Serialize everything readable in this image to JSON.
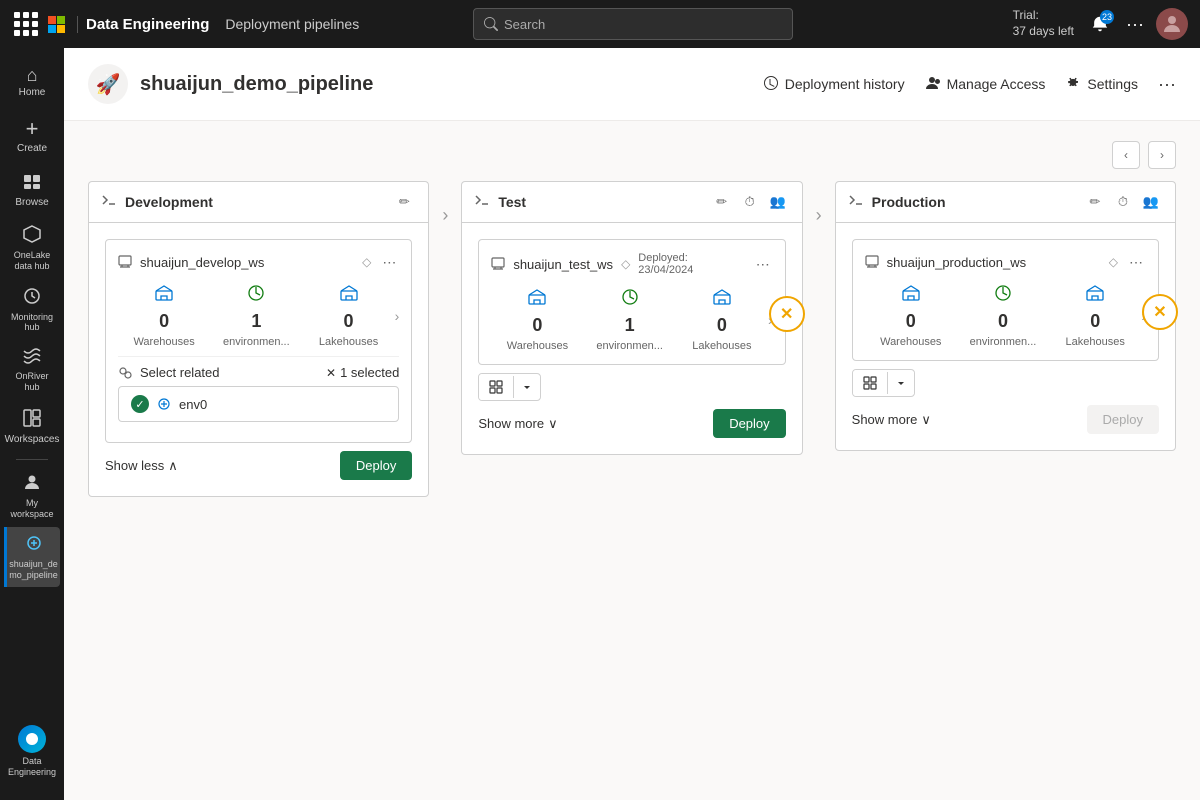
{
  "topbar": {
    "brand": "Data Engineering",
    "page": "Deployment pipelines",
    "search_placeholder": "Search",
    "trial_line1": "Trial:",
    "trial_line2": "37 days left",
    "notif_count": "23"
  },
  "sidebar": {
    "items": [
      {
        "id": "home",
        "label": "Home",
        "icon": "⌂"
      },
      {
        "id": "create",
        "label": "Create",
        "icon": "+"
      },
      {
        "id": "browse",
        "label": "Browse",
        "icon": "📁"
      },
      {
        "id": "onelake",
        "label": "OneLake data hub",
        "icon": "⬡"
      },
      {
        "id": "monitoring",
        "label": "Monitoring hub",
        "icon": "⟳"
      },
      {
        "id": "oneriver",
        "label": "OnRiver hub",
        "icon": "〜"
      },
      {
        "id": "workspaces",
        "label": "Workspaces",
        "icon": "◫"
      },
      {
        "id": "myworkspace",
        "label": "My workspace",
        "icon": "👤"
      },
      {
        "id": "shuaijun",
        "label": "shuaijun_de mo_pipeline",
        "icon": "⟳",
        "active": true
      }
    ],
    "data_engineering": "Data Engineering"
  },
  "page": {
    "title": "shuaijun_demo_pipeline",
    "icon": "🚀",
    "actions": {
      "deployment_history": "Deployment history",
      "manage_access": "Manage Access",
      "settings": "Settings"
    }
  },
  "stages": [
    {
      "id": "development",
      "title": "Development",
      "workspace_name": "shuaijun_develop_ws",
      "diamond": "◇",
      "deployed_text": null,
      "stats": [
        {
          "icon": "🏠",
          "value": "0",
          "label": "Warehouses"
        },
        {
          "icon": "⚙",
          "value": "1",
          "label": "environmen..."
        },
        {
          "icon": "🏠",
          "value": "0",
          "label": "Lakehouses"
        }
      ],
      "status": null,
      "show_more_label": null,
      "show_less_label": "Show less",
      "deploy_label": "Deploy",
      "select_related_label": "Select related",
      "selected_count": "1 selected",
      "related_items": [
        {
          "name": "env0",
          "checked": true
        }
      ]
    },
    {
      "id": "test",
      "title": "Test",
      "workspace_name": "shuaijun_test_ws",
      "diamond": "◇",
      "deployed_text": "Deployed: 23/04/2024",
      "stats": [
        {
          "icon": "🏠",
          "value": "0",
          "label": "Warehouses"
        },
        {
          "icon": "⚙",
          "value": "1",
          "label": "environmen..."
        },
        {
          "icon": "🏠",
          "value": "0",
          "label": "Lakehouses"
        }
      ],
      "status": "warning",
      "show_more_label": "Show more",
      "show_less_label": null,
      "deploy_label": "Deploy"
    },
    {
      "id": "production",
      "title": "Production",
      "workspace_name": "shuaijun_production_ws",
      "diamond": "◇",
      "deployed_text": null,
      "stats": [
        {
          "icon": "🏠",
          "value": "0",
          "label": "Warehouses"
        },
        {
          "icon": "⚙",
          "value": "0",
          "label": "environmen..."
        },
        {
          "icon": "🏠",
          "value": "0",
          "label": "Lakehouses"
        }
      ],
      "status": "warning",
      "show_more_label": "Show more",
      "show_less_label": null,
      "deploy_label": "Deploy",
      "deploy_disabled": true
    }
  ]
}
